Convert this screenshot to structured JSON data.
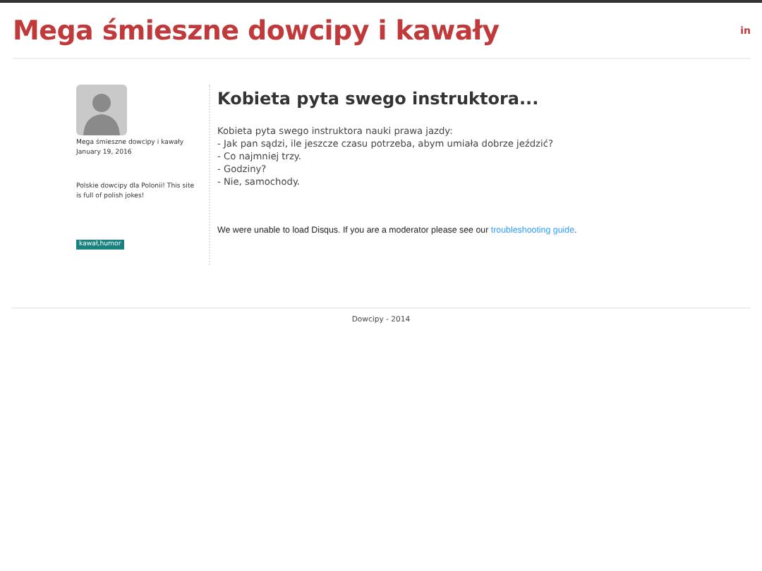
{
  "header": {
    "title": "Mega śmieszne dowcipy i kawały",
    "social_icon": "in"
  },
  "sidebar": {
    "author": "Mega śmieszne dowcipy i kawały",
    "date": "January 19, 2016",
    "description": "Polskie dowcipy dla Polonii! This site is full of polish jokes!",
    "tags": [
      "kawał,humor"
    ]
  },
  "post": {
    "title": "Kobieta pyta swego instruktora...",
    "lines": [
      "Kobieta pyta swego instruktora nauki prawa jazdy:",
      "- Jak pan sądzi, ile jeszcze czasu potrzeba, abym umiała dobrze jeździć?",
      "- Co najmniej trzy.",
      "- Godziny?",
      "- Nie, samochody."
    ]
  },
  "comments": {
    "message": "We were unable to load Disqus. If you are a moderator please see our",
    "link": "troubleshooting guide",
    "end": "."
  },
  "footer": "Dowcipy - 2014"
}
